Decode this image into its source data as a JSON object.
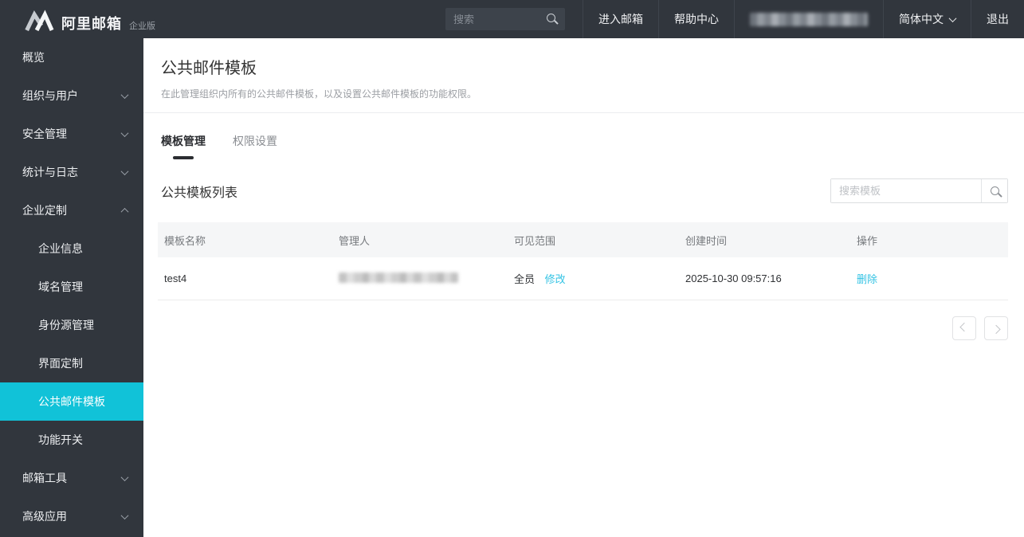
{
  "topbar": {
    "brand_name": "阿里邮箱",
    "brand_edition": "企业版",
    "search_placeholder": "搜索",
    "enter_mailbox": "进入邮箱",
    "help_center": "帮助中心",
    "account_redacted": true,
    "language": "简体中文",
    "logout": "退出"
  },
  "sidebar": {
    "items": [
      {
        "label": "概览"
      },
      {
        "label": "组织与用户",
        "chevron": "down"
      },
      {
        "label": "安全管理",
        "chevron": "down"
      },
      {
        "label": "统计与日志",
        "chevron": "down"
      },
      {
        "label": "企业定制",
        "chevron": "up",
        "expanded": true
      },
      {
        "label": "企业信息",
        "sub": true
      },
      {
        "label": "域名管理",
        "sub": true
      },
      {
        "label": "身份源管理",
        "sub": true
      },
      {
        "label": "界面定制",
        "sub": true
      },
      {
        "label": "公共邮件模板",
        "sub": true,
        "active": true
      },
      {
        "label": "功能开关",
        "sub": true
      },
      {
        "label": "邮箱工具",
        "chevron": "down"
      },
      {
        "label": "高级应用",
        "chevron": "down"
      }
    ]
  },
  "page": {
    "title": "公共邮件模板",
    "description": "在此管理组织内所有的公共邮件模板，以及设置公共邮件模板的功能权限。",
    "tabs": [
      {
        "label": "模板管理",
        "active": true
      },
      {
        "label": "权限设置",
        "active": false
      }
    ],
    "section_title": "公共模板列表",
    "search_placeholder": "搜索模板"
  },
  "table": {
    "columns": [
      "模板名称",
      "管理人",
      "可见范围",
      "创建时间",
      "操作"
    ],
    "rows": [
      {
        "name": "test4",
        "manager_redacted": true,
        "visibility": "全员",
        "modify_link": "修改",
        "created": "2025-10-30 09:57:16",
        "delete_link": "删除"
      }
    ]
  },
  "colors": {
    "topbar_bg": "#31363d",
    "sidebar_active": "#11c2d8",
    "link": "#33c3e4"
  }
}
